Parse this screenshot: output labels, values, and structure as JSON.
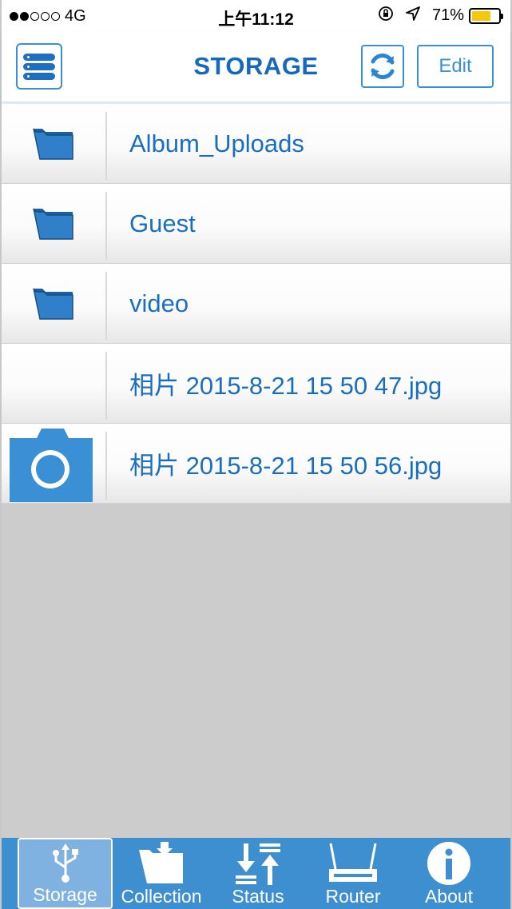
{
  "status_bar": {
    "carrier": "4G",
    "time": "上午11:12",
    "battery_percent": "71%",
    "battery_level": 0.71,
    "battery_color": "#f7c70b"
  },
  "nav": {
    "title": "STORAGE",
    "edit_label": "Edit"
  },
  "files": [
    {
      "name": "Album_Uploads",
      "type": "folder"
    },
    {
      "name": "Guest",
      "type": "folder"
    },
    {
      "name": "video",
      "type": "folder"
    },
    {
      "name": "相片 2015-8-21 15 50 47.jpg",
      "type": "image-no-thumb"
    },
    {
      "name": "相片 2015-8-21 15 50 56.jpg",
      "type": "image-camera-thumb"
    }
  ],
  "tabs": [
    {
      "label": "Storage",
      "icon": "usb-icon",
      "active": true
    },
    {
      "label": "Collection",
      "icon": "collection-folder-icon",
      "active": false
    },
    {
      "label": "Status",
      "icon": "transfer-status-icon",
      "active": false
    },
    {
      "label": "Router",
      "icon": "router-icon",
      "active": false
    },
    {
      "label": "About",
      "icon": "info-icon",
      "active": false
    }
  ],
  "colors": {
    "accent": "#1668bf",
    "tab_bar": "#3e8fd0",
    "folder": "#2f7fc9",
    "empty_area": "#cccccc"
  }
}
